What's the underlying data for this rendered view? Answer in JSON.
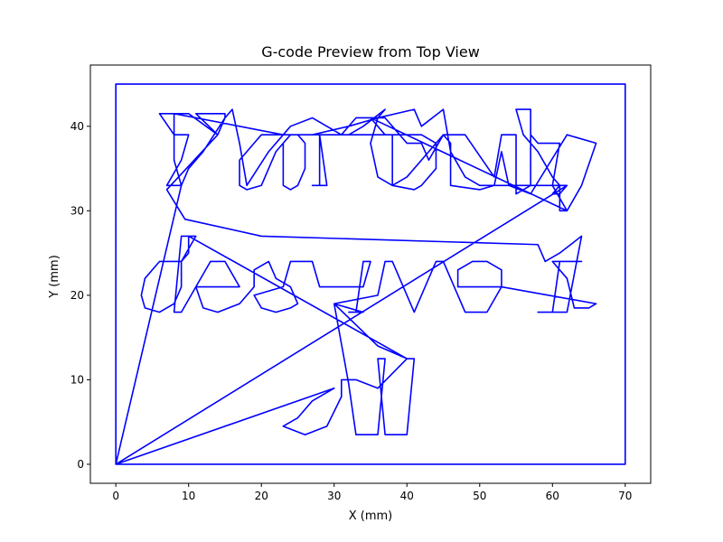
{
  "chart_data": {
    "type": "line",
    "title": "G-code Preview from Top View",
    "xlabel": "X (mm)",
    "ylabel": "Y (mm)",
    "xlim": [
      -3.5,
      73.5
    ],
    "ylim": [
      -2.25,
      47.25
    ],
    "x_ticks": [
      0,
      10,
      20,
      30,
      40,
      50,
      60,
      70
    ],
    "y_ticks": [
      0,
      10,
      20,
      30,
      40
    ],
    "grid": false,
    "colors": {
      "path": "#0000ff",
      "axes": "#000000",
      "background": "#ffffff"
    },
    "series": [
      {
        "points": [
          [
            0,
            0
          ],
          [
            0,
            45
          ],
          [
            70,
            45
          ],
          [
            70,
            0
          ],
          [
            0,
            0
          ],
          [
            30,
            9
          ],
          [
            27,
            7.5
          ],
          [
            25,
            5.5
          ],
          [
            23,
            4.5
          ],
          [
            26,
            3.5
          ],
          [
            29,
            4.5
          ],
          [
            31,
            8
          ],
          [
            31,
            10
          ],
          [
            33,
            10
          ],
          [
            36,
            9
          ],
          [
            40,
            12.5
          ],
          [
            41,
            12.5
          ],
          [
            40,
            3.5
          ],
          [
            37,
            3.5
          ],
          [
            36,
            12.5
          ],
          [
            37,
            12.5
          ],
          [
            36,
            3.5
          ],
          [
            33,
            3.5
          ],
          [
            32,
            9.5
          ],
          [
            30,
            19
          ],
          [
            36,
            14
          ],
          [
            40,
            12.5
          ],
          [
            10,
            27
          ],
          [
            10,
            25
          ],
          [
            9,
            24
          ],
          [
            6,
            24
          ],
          [
            4,
            22
          ],
          [
            3.5,
            20
          ],
          [
            4,
            18.5
          ],
          [
            6,
            18
          ],
          [
            8,
            19
          ],
          [
            9,
            21
          ],
          [
            9,
            24
          ],
          [
            11,
            27
          ],
          [
            9,
            27
          ],
          [
            8,
            18
          ],
          [
            9,
            18
          ],
          [
            11,
            21
          ],
          [
            13,
            24
          ],
          [
            15,
            24
          ],
          [
            17,
            21
          ],
          [
            11,
            21
          ],
          [
            12,
            18.5
          ],
          [
            14,
            18
          ],
          [
            17,
            19
          ],
          [
            18,
            20
          ],
          [
            19,
            21
          ],
          [
            19,
            23
          ],
          [
            21,
            24
          ],
          [
            22,
            22
          ],
          [
            24,
            21
          ],
          [
            25,
            19
          ],
          [
            24,
            18.5
          ],
          [
            22,
            18
          ],
          [
            20,
            18.5
          ],
          [
            19,
            20
          ],
          [
            23,
            21
          ],
          [
            24,
            24
          ],
          [
            27,
            24
          ],
          [
            28,
            21
          ],
          [
            34,
            21
          ],
          [
            35,
            24
          ],
          [
            34,
            24
          ],
          [
            33,
            18
          ],
          [
            32,
            18
          ],
          [
            34,
            18
          ],
          [
            30,
            19
          ],
          [
            36,
            20
          ],
          [
            37,
            24
          ],
          [
            38,
            24
          ],
          [
            41,
            18
          ],
          [
            44,
            24
          ],
          [
            45,
            24
          ],
          [
            48,
            18
          ],
          [
            51,
            18
          ],
          [
            53,
            21
          ],
          [
            53,
            23
          ],
          [
            51,
            24
          ],
          [
            49,
            24
          ],
          [
            47,
            23
          ],
          [
            47,
            21
          ],
          [
            53,
            21
          ],
          [
            66,
            19
          ],
          [
            65,
            18.5
          ],
          [
            63,
            18.5
          ],
          [
            62,
            22
          ],
          [
            60,
            24
          ],
          [
            64,
            24
          ],
          [
            61,
            24
          ],
          [
            60,
            18
          ],
          [
            58,
            18
          ],
          [
            62,
            18
          ],
          [
            64,
            27
          ],
          [
            61,
            25
          ],
          [
            59,
            24
          ],
          [
            58,
            26
          ],
          [
            20,
            27
          ],
          [
            9.5,
            29
          ],
          [
            7,
            32.5
          ],
          [
            14,
            39
          ],
          [
            15,
            41
          ],
          [
            16,
            42
          ],
          [
            17,
            38
          ],
          [
            18,
            33
          ],
          [
            21,
            37
          ],
          [
            23,
            39
          ],
          [
            24,
            40
          ],
          [
            27,
            41
          ],
          [
            29,
            40
          ],
          [
            31,
            39
          ],
          [
            33,
            41
          ],
          [
            37,
            41
          ],
          [
            38,
            40
          ],
          [
            40,
            38
          ],
          [
            42,
            38
          ],
          [
            43,
            36
          ],
          [
            45,
            39
          ],
          [
            48,
            39
          ],
          [
            52,
            34
          ],
          [
            53,
            39
          ],
          [
            55,
            39
          ],
          [
            55,
            32
          ],
          [
            57,
            33
          ],
          [
            57,
            39
          ],
          [
            58,
            38
          ],
          [
            61,
            38
          ],
          [
            60,
            33
          ],
          [
            62,
            30
          ],
          [
            64,
            33
          ],
          [
            66,
            38
          ],
          [
            62,
            39
          ],
          [
            57,
            32
          ],
          [
            54,
            33
          ],
          [
            53,
            37
          ],
          [
            52,
            33
          ],
          [
            50,
            32.5
          ],
          [
            46,
            33
          ],
          [
            46,
            38
          ],
          [
            45,
            39
          ],
          [
            43,
            37
          ],
          [
            40,
            34
          ],
          [
            38,
            33
          ],
          [
            36,
            34
          ],
          [
            35,
            38
          ],
          [
            36,
            41
          ],
          [
            41,
            42
          ],
          [
            42,
            40
          ],
          [
            45,
            42
          ],
          [
            46,
            37
          ],
          [
            48,
            34
          ],
          [
            50,
            33
          ],
          [
            55,
            33
          ],
          [
            61,
            33
          ],
          [
            60,
            34
          ],
          [
            58,
            37
          ],
          [
            56,
            39
          ],
          [
            55,
            42
          ],
          [
            57,
            42
          ],
          [
            57,
            33
          ],
          [
            62,
            33
          ],
          [
            61,
            32
          ],
          [
            60,
            32
          ],
          [
            61,
            33
          ],
          [
            61,
            30
          ],
          [
            62,
            30
          ],
          [
            35,
            41
          ],
          [
            37,
            39
          ],
          [
            41,
            39
          ],
          [
            38,
            39
          ],
          [
            38,
            33
          ],
          [
            41,
            32.5
          ],
          [
            42,
            33
          ],
          [
            44,
            35
          ],
          [
            44,
            38
          ],
          [
            42,
            39
          ],
          [
            41,
            39
          ],
          [
            27,
            39
          ],
          [
            32,
            40
          ],
          [
            36,
            41
          ],
          [
            37,
            42
          ],
          [
            34,
            40
          ],
          [
            32,
            39
          ],
          [
            28,
            39
          ],
          [
            28,
            33
          ],
          [
            27,
            33
          ],
          [
            29,
            33
          ],
          [
            28,
            39
          ],
          [
            27,
            39
          ],
          [
            20,
            39
          ],
          [
            19,
            38
          ],
          [
            17,
            36
          ],
          [
            17,
            33
          ],
          [
            18,
            32.5
          ],
          [
            20,
            33
          ],
          [
            21,
            35
          ],
          [
            22,
            37
          ],
          [
            23,
            38
          ],
          [
            24,
            39
          ],
          [
            23,
            38
          ],
          [
            23,
            33
          ],
          [
            24,
            32.5
          ],
          [
            25,
            33
          ],
          [
            26,
            35
          ],
          [
            26,
            38
          ],
          [
            25,
            39
          ],
          [
            23,
            39
          ],
          [
            8,
            41.5
          ],
          [
            6,
            41.5
          ],
          [
            8,
            39
          ],
          [
            10,
            39
          ],
          [
            9,
            36
          ],
          [
            7,
            33
          ],
          [
            9,
            33
          ],
          [
            8,
            36
          ],
          [
            8,
            41.5
          ],
          [
            6,
            41.5
          ],
          [
            10,
            41.5
          ],
          [
            14,
            39
          ],
          [
            11,
            41.5
          ],
          [
            15,
            41.5
          ],
          [
            15,
            41
          ],
          [
            12,
            37
          ],
          [
            10,
            35
          ],
          [
            9,
            33
          ],
          [
            0,
            0
          ],
          [
            62,
            33
          ]
        ]
      }
    ]
  }
}
